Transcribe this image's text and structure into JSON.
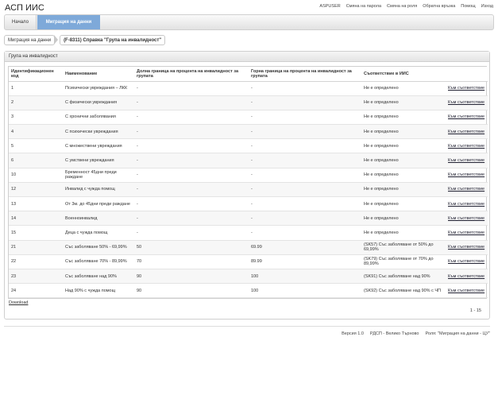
{
  "app": {
    "title": "АСП ИИС"
  },
  "top_links": [
    "ASPUSER",
    "Смяна на парола",
    "Смяна на роля",
    "Обратна връзка",
    "Помощ",
    "Изход"
  ],
  "nav": {
    "home": "Начало",
    "active": "Миграция на данни"
  },
  "breadcrumb": {
    "root": "Миграция на данни",
    "current": "(F-8311) Справка \"Група на инвалидност\""
  },
  "panel": {
    "title": "Група на инвалидност"
  },
  "table": {
    "headers": [
      "Идентификационен код",
      "Наименование",
      "Долна граница на процента на инвалидност за групата",
      "Горна граница на процента на инвалидност за групата",
      "Съответствие в ИИС",
      ""
    ],
    "link_label": "Към съответствие",
    "rows": [
      [
        "1",
        "Психически увреждания – ЛКК",
        "-",
        "-",
        "Не е определено"
      ],
      [
        "2",
        "С физически увреждания",
        "-",
        "-",
        "Не е определено"
      ],
      [
        "3",
        "С хронични заболявания",
        "-",
        "-",
        "Не е определено"
      ],
      [
        "4",
        "С психически увреждания",
        "-",
        "-",
        "Не е определено"
      ],
      [
        "5",
        "С множествени увреждания",
        "-",
        "-",
        "Не е определено"
      ],
      [
        "6",
        "С умствени увреждания",
        "-",
        "-",
        "Не е определено"
      ],
      [
        "10",
        "Бременност 45дни преди раждане",
        "-",
        "-",
        "Не е определено"
      ],
      [
        "12",
        "Инвалид с чужда помощ",
        "-",
        "-",
        "Не е определено"
      ],
      [
        "13",
        "От 3м. до 45дни преди раждане",
        "-",
        "-",
        "Не е определено"
      ],
      [
        "14",
        "Военноинвалид",
        "-",
        "-",
        "Не е определено"
      ],
      [
        "15",
        "Деца с чужда помощ",
        "-",
        "-",
        "Не е определено"
      ],
      [
        "21",
        "Със заболяване 50% - 69,99%",
        "50",
        "69.99",
        "(SK57) Със заболяване от 50% до 69,99%"
      ],
      [
        "22",
        "Със заболяване 70% - 89,99%",
        "70",
        "89.99",
        "(SK79) Със заболяване от 70% до 89,99%"
      ],
      [
        "23",
        "Със заболяване над 90%",
        "90",
        "100",
        "(SK91) Със заболяване над 90%"
      ],
      [
        "24",
        "Над 90% с чужда помощ",
        "90",
        "100",
        "(SK92) Със заболяване над 90% с ЧП"
      ]
    ]
  },
  "download": "Download",
  "pager": "1 - 15",
  "footer": [
    "Версия 1.0",
    "РДСП - Велико Търново",
    "Роля: \"Миграция на данни - ЦУ\""
  ]
}
